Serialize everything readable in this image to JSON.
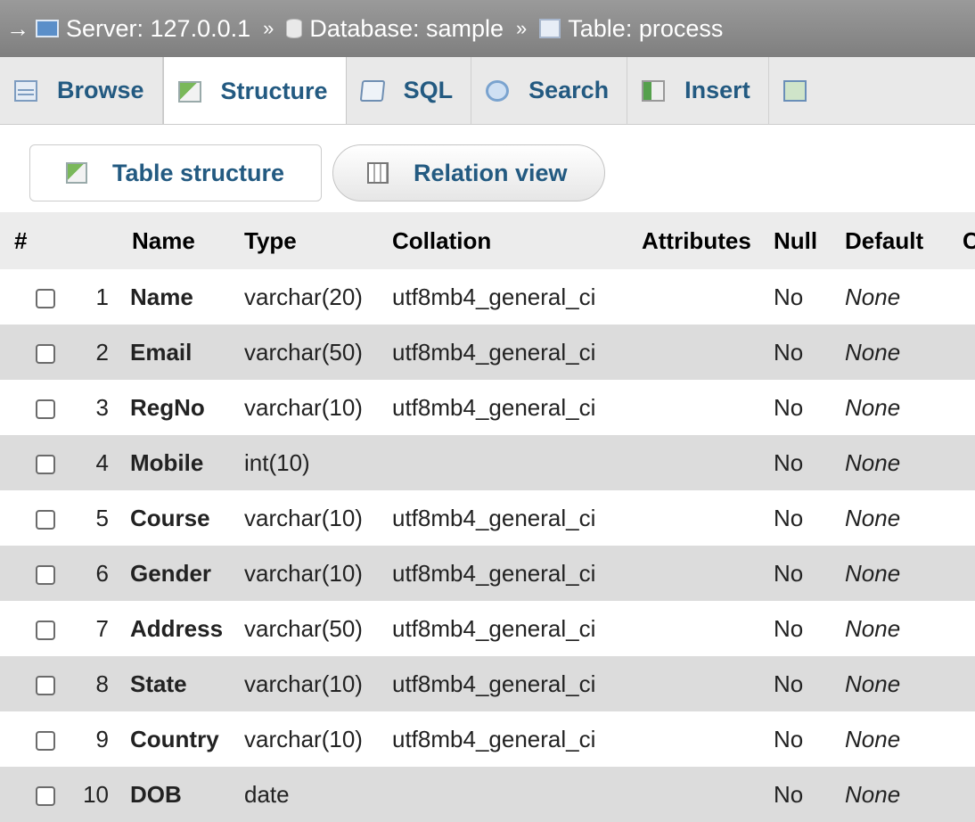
{
  "breadcrumb": {
    "arrow": "→",
    "server": "Server: 127.0.0.1",
    "database": "Database: sample",
    "table": "Table: process",
    "separator": "»"
  },
  "tabs": [
    {
      "label": "Browse",
      "icon": "browse-icon"
    },
    {
      "label": "Structure",
      "icon": "structure-icon",
      "active": true
    },
    {
      "label": "SQL",
      "icon": "sql-icon"
    },
    {
      "label": "Search",
      "icon": "search-icon"
    },
    {
      "label": "Insert",
      "icon": "insert-icon"
    },
    {
      "label": "",
      "icon": "export-icon"
    }
  ],
  "subtabs": {
    "table_structure": "Table structure",
    "relation_view": "Relation view"
  },
  "columns_header": {
    "num": "#",
    "name": "Name",
    "type": "Type",
    "collation": "Collation",
    "attributes": "Attributes",
    "null": "Null",
    "default": "Default",
    "comments": "C"
  },
  "rows": [
    {
      "num": "1",
      "name": "Name",
      "type": "varchar(20)",
      "collation": "utf8mb4_general_ci",
      "attributes": "",
      "null": "No",
      "default": "None"
    },
    {
      "num": "2",
      "name": "Email",
      "type": "varchar(50)",
      "collation": "utf8mb4_general_ci",
      "attributes": "",
      "null": "No",
      "default": "None"
    },
    {
      "num": "3",
      "name": "RegNo",
      "type": "varchar(10)",
      "collation": "utf8mb4_general_ci",
      "attributes": "",
      "null": "No",
      "default": "None"
    },
    {
      "num": "4",
      "name": "Mobile",
      "type": "int(10)",
      "collation": "",
      "attributes": "",
      "null": "No",
      "default": "None"
    },
    {
      "num": "5",
      "name": "Course",
      "type": "varchar(10)",
      "collation": "utf8mb4_general_ci",
      "attributes": "",
      "null": "No",
      "default": "None"
    },
    {
      "num": "6",
      "name": "Gender",
      "type": "varchar(10)",
      "collation": "utf8mb4_general_ci",
      "attributes": "",
      "null": "No",
      "default": "None"
    },
    {
      "num": "7",
      "name": "Address",
      "type": "varchar(50)",
      "collation": "utf8mb4_general_ci",
      "attributes": "",
      "null": "No",
      "default": "None"
    },
    {
      "num": "8",
      "name": "State",
      "type": "varchar(10)",
      "collation": "utf8mb4_general_ci",
      "attributes": "",
      "null": "No",
      "default": "None"
    },
    {
      "num": "9",
      "name": "Country",
      "type": "varchar(10)",
      "collation": "utf8mb4_general_ci",
      "attributes": "",
      "null": "No",
      "default": "None"
    },
    {
      "num": "10",
      "name": "DOB",
      "type": "date",
      "collation": "",
      "attributes": "",
      "null": "No",
      "default": "None"
    }
  ],
  "colors": {
    "link": "#235a81",
    "breadcrumb_bg": "#8c8c8c",
    "row_alt": "#dcdcdc"
  }
}
